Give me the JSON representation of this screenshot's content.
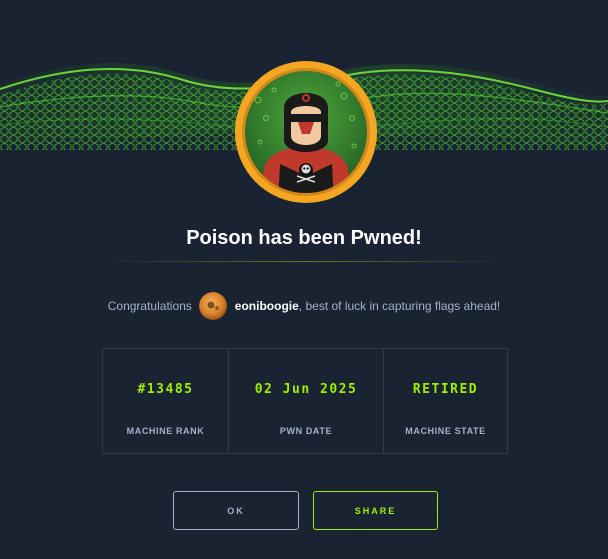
{
  "title": "Poison has been Pwned!",
  "congrats": {
    "prefix": "Congratulations",
    "username": "eoniboogie",
    "suffix": ", best of luck in capturing flags ahead!"
  },
  "stats": [
    {
      "value": "#13485",
      "label": "MACHINE RANK"
    },
    {
      "value": "02 Jun 2025",
      "label": "PWN DATE"
    },
    {
      "value": "RETIRED",
      "label": "MACHINE STATE"
    }
  ],
  "buttons": {
    "ok": "OK",
    "share": "SHARE"
  },
  "colors": {
    "accent": "#9fef00",
    "background": "#1a2332",
    "muted": "#a4b1cd",
    "ring": "#f5a623"
  },
  "icons": {
    "machine_avatar": "hooded-skull-figure-icon",
    "user_avatar": "user-avatar-icon"
  }
}
